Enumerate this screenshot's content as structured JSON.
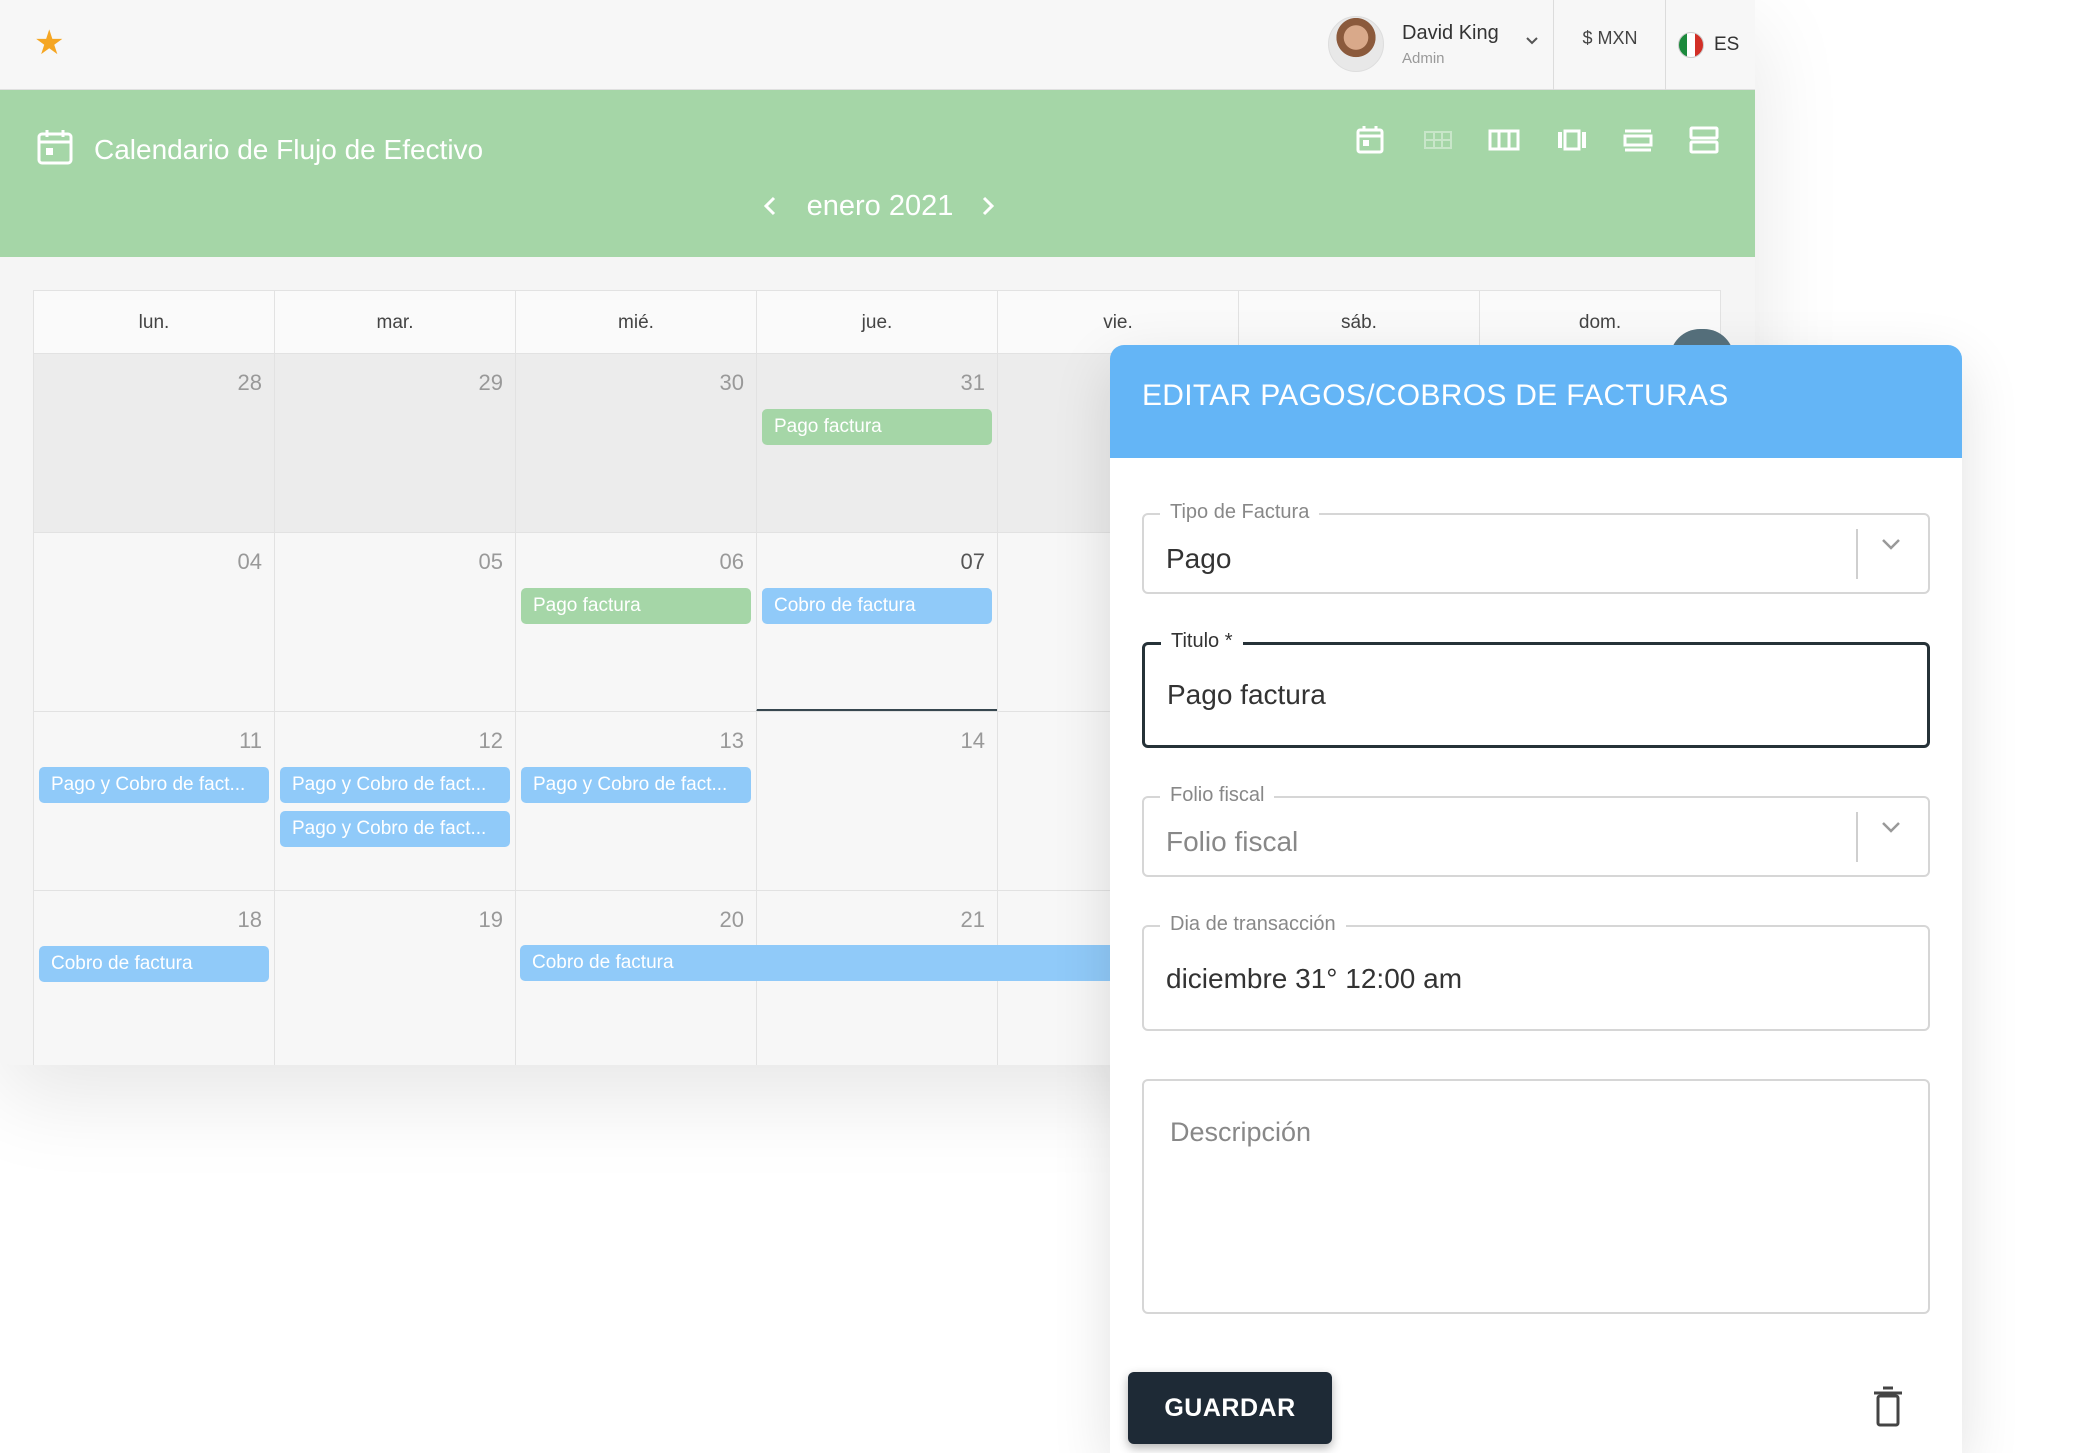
{
  "topbar": {
    "user_name": "David King",
    "user_role": "Admin",
    "currency": "$ MXN",
    "language": "ES"
  },
  "calendar": {
    "title": "Calendario de Flujo de Efectivo",
    "month": "enero 2021",
    "weekdays": [
      "lun.",
      "mar.",
      "mié.",
      "jue.",
      "vie.",
      "sáb.",
      "dom."
    ],
    "weeks": [
      [
        "28",
        "29",
        "30",
        "31"
      ],
      [
        "04",
        "05",
        "06",
        "07"
      ],
      [
        "11",
        "12",
        "13",
        "14"
      ],
      [
        "18",
        "19",
        "20",
        "21"
      ]
    ],
    "events": {
      "w1_jue": "Pago factura",
      "w2_mie": "Pago factura",
      "w2_jue": "Cobro de factura",
      "w3_lun": "Pago y Cobro de fact...",
      "w3_mar_1": "Pago y Cobro de fact...",
      "w3_mar_2": "Pago y Cobro de fact...",
      "w3_mie": "Pago y Cobro de fact...",
      "w4_lun": "Cobro de factura",
      "w4_mie": "Cobro de factura"
    },
    "colors": {
      "pago": "#a5d6a7",
      "cobro": "#90caf9",
      "header": "#a5d6a7"
    }
  },
  "dialog": {
    "title": "EDITAR PAGOS/COBROS DE FACTURAS",
    "tipo_label": "Tipo de Factura",
    "tipo_value": "Pago",
    "titulo_label": "Titulo *",
    "titulo_value": "Pago factura",
    "folio_label": "Folio fiscal",
    "folio_placeholder": "Folio fiscal",
    "dia_label": "Dia de transacción",
    "dia_value": "diciembre 31° 12:00 am",
    "descripcion_placeholder": "Descripción",
    "save_label": "GUARDAR",
    "header_color": "#64b5f6"
  }
}
